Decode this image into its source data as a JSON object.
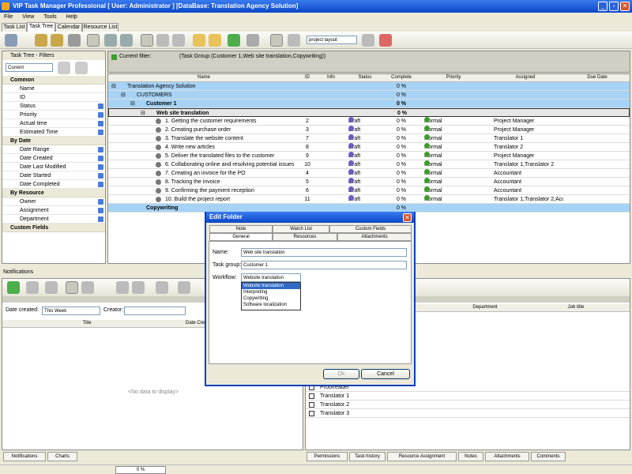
{
  "app": {
    "title": "VIP Task Manager Professional [ User: Administrator ] [DataBase: Translation Agency Solution]",
    "menu": [
      "File",
      "View",
      "Tools",
      "Help"
    ],
    "tabs": [
      "Task List",
      "Task Tree",
      "Calendar",
      "Resource List"
    ],
    "active_tab": "Task Tree",
    "layout_select": "project layout",
    "accent": "#0a47c7"
  },
  "filters_panel": {
    "title": "Task Tree - Filters",
    "current_value": "Current",
    "sections": [
      {
        "label": "Common",
        "items": [
          "Name",
          "ID",
          "Status",
          "Priority",
          "Actual time",
          "Estimated Time"
        ]
      },
      {
        "label": "By Date",
        "items": [
          "Date Range",
          "Date Created",
          "Date Last Modified",
          "Date Started",
          "Date Completed"
        ]
      },
      {
        "label": "By Resource",
        "items": [
          "Owner",
          "Assignment",
          "Department"
        ]
      },
      {
        "label": "Custom Fields",
        "items": []
      }
    ]
  },
  "current_filter": {
    "label": "Current filter:",
    "value": "(Task Group  (Customer 1,Web site translation,Copywriting))"
  },
  "grid": {
    "headers": [
      "Name",
      "ID",
      "Info",
      "Status",
      "Complete",
      "Priority",
      "Assigned",
      "Due Date"
    ],
    "root": "Translation Agency Solution",
    "root_complete": "0 %",
    "customers": "CUSTOMERS",
    "customers_complete": "0 %",
    "customer1": "Customer 1",
    "customer1_complete": "0 %",
    "folder": "Web site translation",
    "folder_complete": "0 %",
    "tasks": [
      {
        "name": "1. Getting the customer requirements",
        "id": "2",
        "status": "Draft",
        "complete": "0 %",
        "priority": "Normal",
        "assigned": "Project Manager"
      },
      {
        "name": "2. Creating purchase order",
        "id": "3",
        "status": "Draft",
        "complete": "0 %",
        "priority": "Normal",
        "assigned": "Project Manager"
      },
      {
        "name": "3. Translate the website content",
        "id": "7",
        "status": "Draft",
        "complete": "0 %",
        "priority": "Normal",
        "assigned": "Translator 1"
      },
      {
        "name": "4. Write new articles",
        "id": "8",
        "status": "Draft",
        "complete": "0 %",
        "priority": "Normal",
        "assigned": "Translator 2"
      },
      {
        "name": "5. Deliver the translated files to the customer",
        "id": "9",
        "status": "Draft",
        "complete": "0 %",
        "priority": "Normal",
        "assigned": "Project Manager"
      },
      {
        "name": "6. Collaborating online and resolving potential issues",
        "id": "10",
        "status": "Draft",
        "complete": "0 %",
        "priority": "Normal",
        "assigned": "Translator 1,Translator 2"
      },
      {
        "name": "7. Creating an invoice for the PO",
        "id": "4",
        "status": "Draft",
        "complete": "0 %",
        "priority": "Normal",
        "assigned": "Accountant"
      },
      {
        "name": "8. Tracking the invoice",
        "id": "5",
        "status": "Draft",
        "complete": "0 %",
        "priority": "Normal",
        "assigned": "Accountant"
      },
      {
        "name": "9. Confirming the payment reception",
        "id": "6",
        "status": "Draft",
        "complete": "0 %",
        "priority": "Normal",
        "assigned": "Accountant"
      },
      {
        "name": "10. Build the project report",
        "id": "11",
        "status": "Draft",
        "complete": "0 %",
        "priority": "Normal",
        "assigned": "Translator 1,Translator 2,Acco"
      }
    ],
    "copywriting": "Copywriting",
    "copywriting_complete": "0 %"
  },
  "notifications": {
    "title": "Notifications",
    "date_created_label": "Date created:",
    "date_created_value": "This Week",
    "creator_label": "Creator:",
    "col_title": "Title",
    "col_date": "Date Cre",
    "empty": "<No data to display>",
    "tabs": [
      "Notifications",
      "Charts"
    ]
  },
  "resources": {
    "col_department": "Department",
    "col_job": "Job title",
    "rows": [
      "Proofreader",
      "Translator 1",
      "Translator 2",
      "Translator 3"
    ],
    "tabs": [
      "Permissions",
      "Task history",
      "Resource Assignment",
      "Notes",
      "Attachments",
      "Comments"
    ]
  },
  "dialog": {
    "title": "Edit Folder",
    "tabs_top": [
      "Note",
      "Watch List",
      "Custom Fields"
    ],
    "tabs_bottom": [
      "General",
      "Resources",
      "Attachments"
    ],
    "name_label": "Name:",
    "name_value": "Web site translation",
    "group_label": "Task group:",
    "group_value": "Customer 1",
    "workflow_label": "Workflow:",
    "workflow_value": "Website translation",
    "workflow_options": [
      "Website translation",
      "Interpreting",
      "Copywriting",
      "Software localization"
    ],
    "ok": "Ok",
    "cancel": "Cancel"
  },
  "status": {
    "progress": "0 %"
  }
}
